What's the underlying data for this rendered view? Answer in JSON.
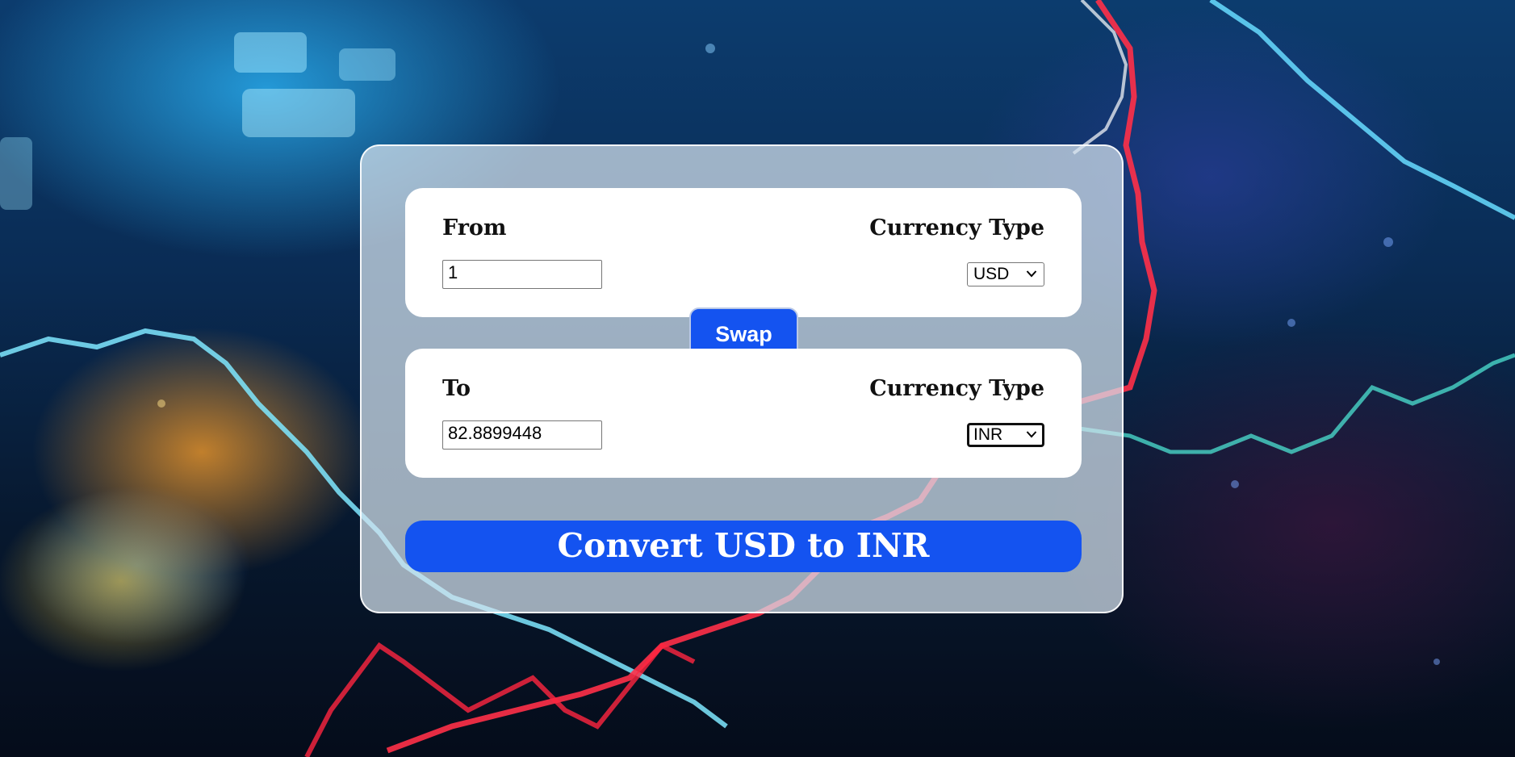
{
  "converter": {
    "from_panel": {
      "label": "From",
      "type_label": "Currency Type",
      "amount_value": "1",
      "currency_selected": "USD"
    },
    "swap_label": "Swap",
    "to_panel": {
      "label": "To",
      "type_label": "Currency Type",
      "amount_value": "82.8899448",
      "currency_selected": "INR"
    },
    "convert_label": "Convert USD to INR"
  },
  "colors": {
    "accent": "#1453f0",
    "panel": "#ffffff",
    "card": "#d7e4f0"
  },
  "icons": {
    "select_chevron": "chevron-down-icon"
  }
}
